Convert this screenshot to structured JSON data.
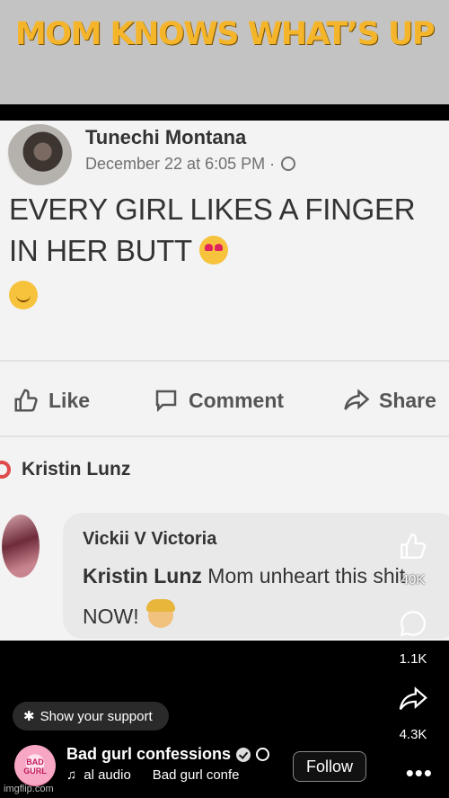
{
  "meme": {
    "caption": "MOM KNOWS WHAT’S UP"
  },
  "post": {
    "author": "Tunechi Montana",
    "date": "December 22 at 6:05 PM ·",
    "text": "EVERY GIRL LIKES A FINGER IN HER BUTT",
    "actions": {
      "like": "Like",
      "comment": "Comment",
      "share": "Share"
    }
  },
  "reply_to": "Kristin Lunz",
  "comment": {
    "author": "Vickii V Victoria",
    "mention": "Kristin Lunz",
    "text": "Mom unheart this shit NOW!"
  },
  "short_actions": {
    "like_count": "40K",
    "comment_count": "1.1K",
    "share_count": "4.3K",
    "more_icon": "more-icon"
  },
  "channel": {
    "support_label": "Show your support",
    "name": "Bad gurl confessions",
    "avatar_text": "BAD GURL",
    "audio": "al audio",
    "audio_channel": "Bad gurl confe",
    "follow_label": "Follow"
  },
  "watermark": "imgflip.com"
}
